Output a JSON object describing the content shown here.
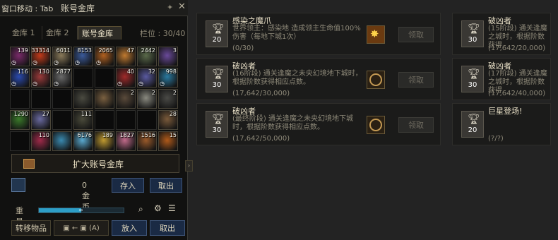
{
  "storage": {
    "move_hint": "窗口移动 : Tab",
    "title": "账号金库",
    "tabs": [
      "金库 1",
      "金库 2",
      "账号金库"
    ],
    "active_tab": 2,
    "slots": "栏位 : 30/40",
    "expand_label": "扩大账号金库",
    "gold_value": "0 金币",
    "deposit": "存入",
    "withdraw": "取出",
    "weight_label": "重量",
    "weight_fraction": 0.5,
    "weight_knob": "∞",
    "transfer_label": "转移物品",
    "transfer_mode": "(A)",
    "put_in": "放入",
    "take_out": "取出",
    "items": [
      {
        "count": "139",
        "color": "#7a2a6a",
        "clock": true
      },
      {
        "count": "33314",
        "color": "#c23a1a",
        "clock": true
      },
      {
        "count": "6011",
        "color": "#8a7a5a",
        "clock": true
      },
      {
        "count": "8153",
        "color": "#3a5a9a",
        "clock": true
      },
      {
        "count": "2065",
        "color": "#b06020",
        "clock": true
      },
      {
        "count": "47",
        "color": "#c07a30",
        "clock": false
      },
      {
        "count": "2442",
        "color": "#5a6a4a",
        "clock": false
      },
      {
        "count": "3",
        "color": "#6a4a9a",
        "clock": false
      },
      {
        "count": "116",
        "color": "#2a4ab0",
        "clock": true
      },
      {
        "count": "130",
        "color": "#9a3a3a",
        "clock": true
      },
      {
        "count": "2877",
        "color": "#6a6a6a",
        "clock": true
      },
      {
        "count": "",
        "color": "",
        "clock": false
      },
      {
        "count": "",
        "color": "",
        "clock": false
      },
      {
        "count": "40",
        "color": "#a02a2a",
        "clock": true
      },
      {
        "count": "32",
        "color": "#5a5aa0",
        "clock": true
      },
      {
        "count": "998",
        "color": "#2a7aa0",
        "clock": true
      },
      {
        "count": "",
        "color": "",
        "clock": false
      },
      {
        "count": "",
        "color": "",
        "clock": false
      },
      {
        "count": "",
        "color": "",
        "clock": false
      },
      {
        "count": "",
        "color": "#4a4a40",
        "clock": false
      },
      {
        "count": "",
        "color": "#7a6040",
        "clock": false
      },
      {
        "count": "2",
        "color": "#5a4a3a",
        "clock": false
      },
      {
        "count": "2",
        "color": "#8a8a80",
        "clock": false
      },
      {
        "count": "2",
        "color": "#4a4a46",
        "clock": false
      },
      {
        "count": "1290",
        "color": "#3a7a2a",
        "clock": false
      },
      {
        "count": "27",
        "color": "#6a6aa0",
        "clock": false
      },
      {
        "count": "",
        "color": "",
        "clock": false
      },
      {
        "count": "111",
        "color": "#4a4a3a",
        "clock": false
      },
      {
        "count": "",
        "color": "",
        "clock": false
      },
      {
        "count": "",
        "color": "",
        "clock": false
      },
      {
        "count": "",
        "color": "",
        "clock": false
      },
      {
        "count": "28",
        "color": "#7a5a3a",
        "clock": false
      },
      {
        "count": "",
        "color": "",
        "clock": false
      },
      {
        "count": "110",
        "color": "#a02a4a",
        "clock": false
      },
      {
        "count": "",
        "color": "#3a8ab0",
        "clock": false
      },
      {
        "count": "6176",
        "color": "#5aaad0",
        "clock": false
      },
      {
        "count": "189",
        "color": "#c09a30",
        "clock": false
      },
      {
        "count": "1827",
        "color": "#c06a8a",
        "clock": false
      },
      {
        "count": "1516",
        "color": "#9a5a2a",
        "clock": false
      },
      {
        "count": "15",
        "color": "#b05a1a",
        "clock": false
      }
    ]
  },
  "achievements": [
    {
      "title": "感染之魔爪",
      "desc": "世界领主：感染地          造成领主生命值100%伤害（每地下城1次）",
      "progress": "(0/30)",
      "points": "20",
      "reward": "star",
      "claim": "领取"
    },
    {
      "title": "破凶者",
      "desc": "(16阶段) 通关逢魔之未央幻境地下城时，根据阶数获得相应点数。",
      "progress": "(17,642/30,000)",
      "points": "30",
      "reward": "emblem",
      "claim": "领取"
    },
    {
      "title": "破凶者",
      "desc": "(最终阶段) 通关逢魔之未央幻境地下城时，根据阶数获得相应点数。",
      "progress": "(17,642/50,000)",
      "points": "30",
      "reward": "emblem",
      "claim": "领取"
    }
  ],
  "achievements_right": [
    {
      "title": "破凶者",
      "desc": "(15阶段) 通关逢魔之城时，根据阶数获得",
      "progress": "(17,642/20,000)",
      "points": "30"
    },
    {
      "title": "破凶者",
      "desc": "(17阶段) 通关逢魔之城时，根据阶数获得",
      "progress": "(17,642/40,000)",
      "points": "30"
    },
    {
      "title": "巨星登场!",
      "desc": "",
      "progress": "(?/?)",
      "points": "20"
    }
  ]
}
